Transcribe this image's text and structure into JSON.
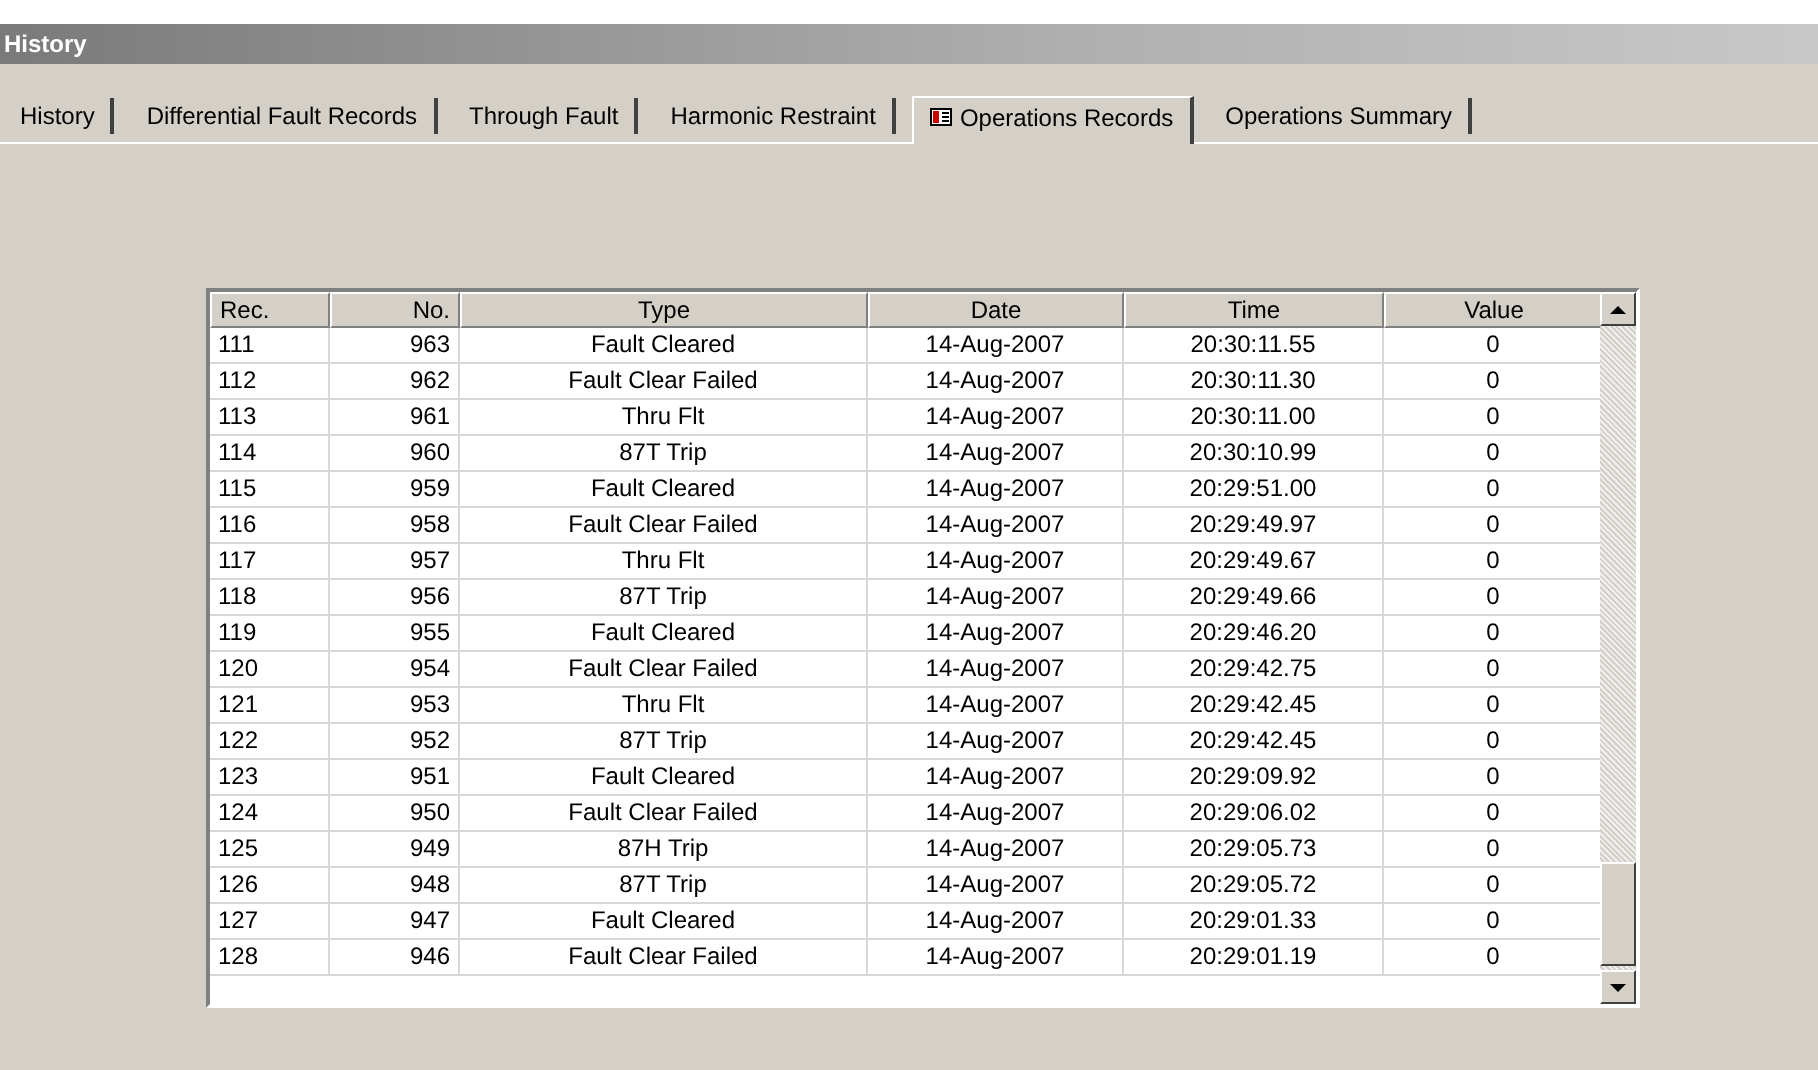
{
  "window": {
    "title": "History"
  },
  "tabs": [
    {
      "label": "History",
      "selected": false,
      "kind": "plain"
    },
    {
      "label": "Differential Fault Records",
      "selected": false,
      "kind": "plain"
    },
    {
      "label": "Through Fault",
      "selected": false,
      "kind": "plain"
    },
    {
      "label": "Harmonic Restraint",
      "selected": false,
      "kind": "plain"
    },
    {
      "label": "Operations Records",
      "selected": true,
      "kind": "with-icon"
    },
    {
      "label": "Operations Summary",
      "selected": false,
      "kind": "plain"
    }
  ],
  "table": {
    "columns": [
      "Rec.",
      "No.",
      "Type",
      "Date",
      "Time",
      "Value"
    ],
    "rows": [
      [
        "111",
        "963",
        "Fault Cleared",
        "14-Aug-2007",
        "20:30:11.55",
        "0"
      ],
      [
        "112",
        "962",
        "Fault Clear Failed",
        "14-Aug-2007",
        "20:30:11.30",
        "0"
      ],
      [
        "113",
        "961",
        "Thru Flt",
        "14-Aug-2007",
        "20:30:11.00",
        "0"
      ],
      [
        "114",
        "960",
        "87T Trip",
        "14-Aug-2007",
        "20:30:10.99",
        "0"
      ],
      [
        "115",
        "959",
        "Fault Cleared",
        "14-Aug-2007",
        "20:29:51.00",
        "0"
      ],
      [
        "116",
        "958",
        "Fault Clear Failed",
        "14-Aug-2007",
        "20:29:49.97",
        "0"
      ],
      [
        "117",
        "957",
        "Thru Flt",
        "14-Aug-2007",
        "20:29:49.67",
        "0"
      ],
      [
        "118",
        "956",
        "87T Trip",
        "14-Aug-2007",
        "20:29:49.66",
        "0"
      ],
      [
        "119",
        "955",
        "Fault Cleared",
        "14-Aug-2007",
        "20:29:46.20",
        "0"
      ],
      [
        "120",
        "954",
        "Fault Clear Failed",
        "14-Aug-2007",
        "20:29:42.75",
        "0"
      ],
      [
        "121",
        "953",
        "Thru Flt",
        "14-Aug-2007",
        "20:29:42.45",
        "0"
      ],
      [
        "122",
        "952",
        "87T Trip",
        "14-Aug-2007",
        "20:29:42.45",
        "0"
      ],
      [
        "123",
        "951",
        "Fault Cleared",
        "14-Aug-2007",
        "20:29:09.92",
        "0"
      ],
      [
        "124",
        "950",
        "Fault Clear Failed",
        "14-Aug-2007",
        "20:29:06.02",
        "0"
      ],
      [
        "125",
        "949",
        "87H Trip",
        "14-Aug-2007",
        "20:29:05.73",
        "0"
      ],
      [
        "126",
        "948",
        "87T Trip",
        "14-Aug-2007",
        "20:29:05.72",
        "0"
      ],
      [
        "127",
        "947",
        "Fault Cleared",
        "14-Aug-2007",
        "20:29:01.33",
        "0"
      ],
      [
        "128",
        "946",
        "Fault Clear Failed",
        "14-Aug-2007",
        "20:29:01.19",
        "0"
      ]
    ]
  }
}
